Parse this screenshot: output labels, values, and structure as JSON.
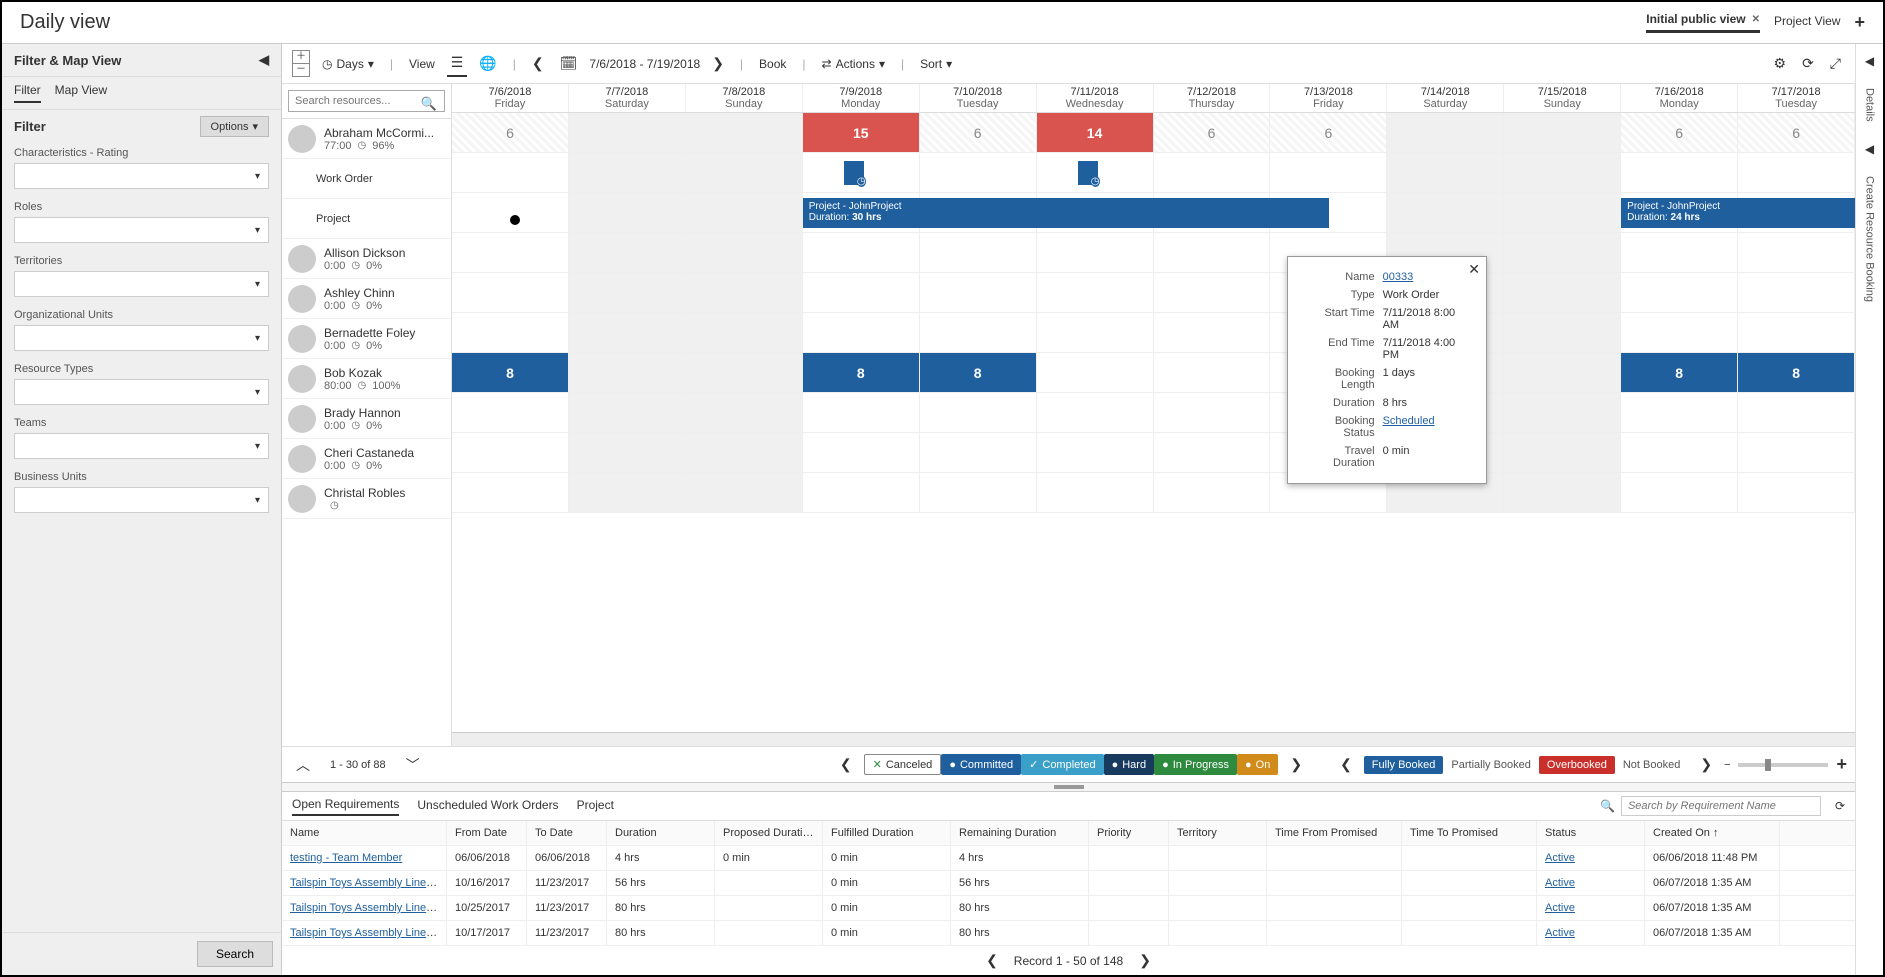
{
  "header": {
    "title": "Daily view",
    "tabs": [
      {
        "label": "Initial public view",
        "active": true,
        "closable": true
      },
      {
        "label": "Project View",
        "active": false,
        "closable": false
      }
    ]
  },
  "filterPanel": {
    "title": "Filter & Map View",
    "tabs": [
      {
        "label": "Filter",
        "active": true
      },
      {
        "label": "Map View",
        "active": false
      }
    ],
    "sectionLabel": "Filter",
    "optionsLabel": "Options",
    "groups": [
      "Characteristics - Rating",
      "Roles",
      "Territories",
      "Organizational Units",
      "Resource Types",
      "Teams",
      "Business Units"
    ],
    "searchLabel": "Search"
  },
  "toolbar": {
    "scale": "Days",
    "viewLabel": "View",
    "dateRange": "7/6/2018 - 7/19/2018",
    "book": "Book",
    "actions": "Actions",
    "sort": "Sort"
  },
  "searchResources": {
    "placeholder": "Search resources..."
  },
  "days": [
    {
      "date": "7/6/2018",
      "dow": "Friday"
    },
    {
      "date": "7/7/2018",
      "dow": "Saturday"
    },
    {
      "date": "7/8/2018",
      "dow": "Sunday"
    },
    {
      "date": "7/9/2018",
      "dow": "Monday"
    },
    {
      "date": "7/10/2018",
      "dow": "Tuesday"
    },
    {
      "date": "7/11/2018",
      "dow": "Wednesday"
    },
    {
      "date": "7/12/2018",
      "dow": "Thursday"
    },
    {
      "date": "7/13/2018",
      "dow": "Friday"
    },
    {
      "date": "7/14/2018",
      "dow": "Saturday"
    },
    {
      "date": "7/15/2018",
      "dow": "Sunday"
    },
    {
      "date": "7/16/2018",
      "dow": "Monday"
    },
    {
      "date": "7/17/2018",
      "dow": "Tuesday"
    }
  ],
  "resources": [
    {
      "name": "Abraham McCormi...",
      "hours": "77:00",
      "pct": "96%",
      "expanded": true,
      "dayVals": [
        "6",
        "",
        "",
        "15",
        "6",
        "14",
        "6",
        "6",
        "",
        "",
        "6",
        "6"
      ],
      "redDays": [
        3,
        5
      ],
      "subrows": [
        {
          "label": "Work Order"
        },
        {
          "label": "Project"
        }
      ]
    },
    {
      "name": "Allison Dickson",
      "hours": "0:00",
      "pct": "0%"
    },
    {
      "name": "Ashley Chinn",
      "hours": "0:00",
      "pct": "0%"
    },
    {
      "name": "Bernadette Foley",
      "hours": "0:00",
      "pct": "0%"
    },
    {
      "name": "Bob Kozak",
      "hours": "80:00",
      "pct": "100%",
      "dayVals": [
        "8",
        "",
        "",
        "8",
        "8",
        "",
        "",
        "",
        "",
        "",
        "8",
        "8"
      ],
      "blueDays": [
        0,
        3,
        4,
        10,
        11
      ]
    },
    {
      "name": "Brady Hannon",
      "hours": "0:00",
      "pct": "0%"
    },
    {
      "name": "Cheri Castaneda",
      "hours": "0:00",
      "pct": "0%"
    },
    {
      "name": "Christal Robles",
      "hours": "",
      "pct": ""
    }
  ],
  "projectBars": [
    {
      "label": "Project - JohnProject",
      "duration": "30 hrs",
      "durLabel": "Duration:"
    },
    {
      "label": "Project - JohnProject",
      "duration": "24 hrs",
      "durLabel": "Duration:"
    }
  ],
  "tooltip": {
    "rows": [
      {
        "k": "Name",
        "v": "00333",
        "link": true
      },
      {
        "k": "Type",
        "v": "Work Order"
      },
      {
        "k": "Start Time",
        "v": "7/11/2018 8:00 AM"
      },
      {
        "k": "End Time",
        "v": "7/11/2018 4:00 PM"
      },
      {
        "k": "Booking Length",
        "v": "1 days"
      },
      {
        "k": "Duration",
        "v": "8 hrs"
      },
      {
        "k": "Booking Status",
        "v": "Scheduled",
        "link": true
      },
      {
        "k": "Travel Duration",
        "v": "0 min"
      }
    ]
  },
  "legend": {
    "pager": "1 - 30 of 88",
    "statuses": [
      {
        "label": "Canceled",
        "cls": "cancel"
      },
      {
        "label": "Committed",
        "cls": "blue"
      },
      {
        "label": "Completed",
        "cls": "teal"
      },
      {
        "label": "Hard",
        "cls": "dblue"
      },
      {
        "label": "In Progress",
        "cls": "green"
      },
      {
        "label": "On",
        "cls": "orange"
      }
    ],
    "bookStates": [
      {
        "label": "Fully Booked",
        "cls": "full"
      },
      {
        "label": "Partially Booked",
        "cls": "plain"
      },
      {
        "label": "Overbooked",
        "cls": "over"
      },
      {
        "label": "Not Booked",
        "cls": "plain"
      }
    ]
  },
  "bottom": {
    "tabs": [
      {
        "label": "Open Requirements",
        "active": true
      },
      {
        "label": "Unscheduled Work Orders",
        "active": false
      },
      {
        "label": "Project",
        "active": false
      }
    ],
    "searchPlaceholder": "Search by Requirement Name",
    "columns": [
      "Name",
      "From Date",
      "To Date",
      "Duration",
      "Proposed Duration",
      "Fulfilled Duration",
      "Remaining Duration",
      "Priority",
      "Territory",
      "Time From Promised",
      "Time To Promised",
      "Status",
      "Created On"
    ],
    "rows": [
      {
        "name": "testing - Team Member",
        "from": "06/06/2018",
        "to": "06/06/2018",
        "dur": "4 hrs",
        "prop": "0 min",
        "ful": "0 min",
        "rem": "4 hrs",
        "status": "Active",
        "created": "06/06/2018 11:48 PM"
      },
      {
        "name": "Tailspin Toys Assembly Line Transfo...",
        "from": "10/16/2017",
        "to": "11/23/2017",
        "dur": "56 hrs",
        "prop": "",
        "ful": "0 min",
        "rem": "56 hrs",
        "status": "Active",
        "created": "06/07/2018 1:35 AM"
      },
      {
        "name": "Tailspin Toys Assembly Line Transfo...",
        "from": "10/25/2017",
        "to": "11/23/2017",
        "dur": "80 hrs",
        "prop": "",
        "ful": "0 min",
        "rem": "80 hrs",
        "status": "Active",
        "created": "06/07/2018 1:35 AM"
      },
      {
        "name": "Tailspin Toys Assembly Line Transfo...",
        "from": "10/17/2017",
        "to": "11/23/2017",
        "dur": "80 hrs",
        "prop": "",
        "ful": "0 min",
        "rem": "80 hrs",
        "status": "Active",
        "created": "06/07/2018 1:35 AM"
      }
    ],
    "pager": "Record 1 - 50 of 148"
  },
  "rightPanels": [
    "Details",
    "Create Resource Booking"
  ]
}
